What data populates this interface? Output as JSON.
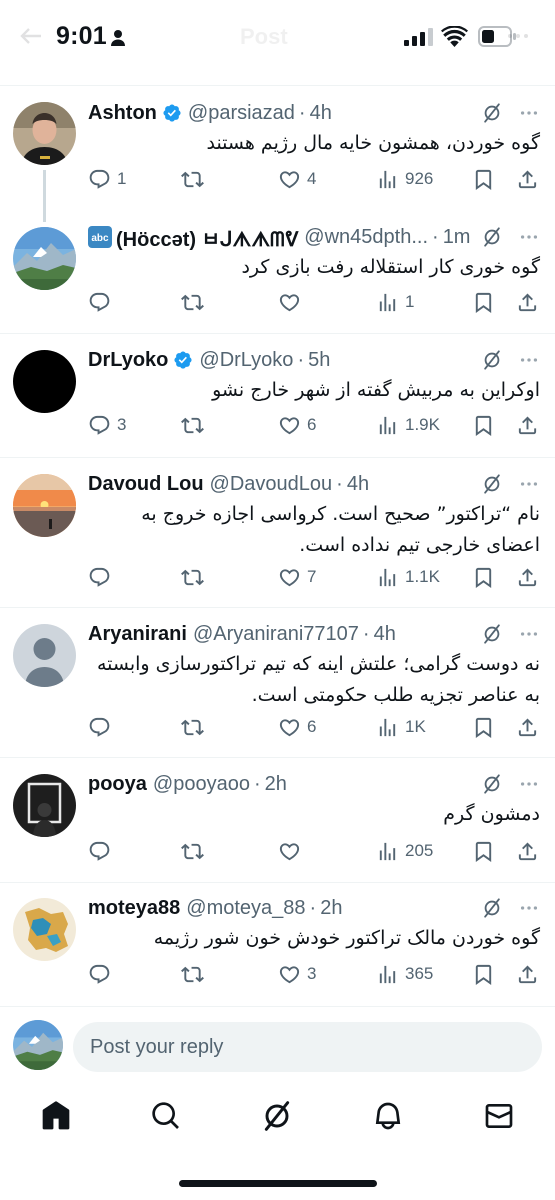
{
  "status_bar": {
    "time": "9:01",
    "ghost_title": "Post",
    "icons": [
      "person-icon",
      "cellular-signal-icon",
      "wifi-icon",
      "battery-icon"
    ]
  },
  "posts": [
    {
      "name": "Ashton",
      "verified": true,
      "handle": "@parsiazad",
      "time": "4h",
      "text": "گوه خوردن، همشون خایه مال رژیم هستند",
      "replies": "1",
      "retweets": "",
      "likes": "4",
      "views": "926"
    },
    {
      "name": "(Höccət) ㅂᒍᗑᗑᗰᕓ",
      "handle": "@wn45dpth...",
      "time": "1m",
      "text": "گوه خوری کار استقلاله رفت بازی کرد",
      "replies": "",
      "retweets": "",
      "likes": "",
      "views": "1"
    },
    {
      "name": "DrLyoko",
      "verified": true,
      "handle": "@DrLyoko",
      "time": "5h",
      "text": "اوکراین به مربیش گفته از شهر خارج نشو",
      "replies": "3",
      "retweets": "",
      "likes": "6",
      "views": "1.9K"
    },
    {
      "name": "Davoud Lou",
      "handle": "@DavoudLou",
      "time": "4h",
      "text_lines": [
        "نام “تراکتور” صحیح است. کرواسی اجازه خروج به",
        "اعضای خارجی تیم نداده است."
      ],
      "replies": "",
      "retweets": "",
      "likes": "7",
      "views": "1.1K"
    },
    {
      "name": "Aryanirani",
      "handle": "@Aryanirani77107",
      "time": "4h",
      "text_lines": [
        "نه دوست گرامی؛ علتش اینه که تیم تراکتورسازی وابسته",
        "به عناصر تجزیه طلب حکومتی است."
      ],
      "replies": "",
      "retweets": "",
      "likes": "6",
      "views": "1K"
    },
    {
      "name": "pooya",
      "handle": "@pooyaoo",
      "time": "2h",
      "text": "دمشون گرم",
      "replies": "",
      "retweets": "",
      "likes": "",
      "views": "205"
    },
    {
      "name": "moteya88",
      "handle": "@moteya_88",
      "time": "2h",
      "text": "گوه خوردن مالک تراکتور خودش خون شور رژیمه",
      "replies": "",
      "retweets": "",
      "likes": "3",
      "views": "365"
    }
  ],
  "reply_bar": {
    "placeholder": "Post your reply"
  },
  "bottom_nav": [
    "home-icon",
    "search-icon",
    "grok-icon",
    "notifications-icon",
    "messages-icon"
  ],
  "colors": {
    "text": "#0f1419",
    "secondary": "#536471",
    "verified": "#1d9bf0",
    "divider": "#eff3f4"
  }
}
